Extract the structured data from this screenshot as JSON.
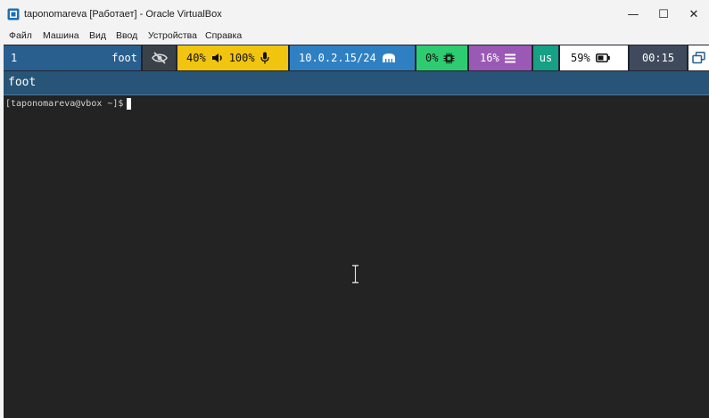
{
  "window": {
    "title": "taponomareva [Работает] - Oracle VirtualBox",
    "minimize_glyph": "—",
    "maximize_glyph": "☐",
    "close_glyph": "✕"
  },
  "menu": [
    {
      "label": "Файл"
    },
    {
      "label": "Машина"
    },
    {
      "label": "Вид"
    },
    {
      "label": "Ввод"
    },
    {
      "label": "Устройства"
    },
    {
      "label": "Справка"
    }
  ],
  "statusbar": {
    "workspace_number": "1",
    "window_name": "foot",
    "idle_icon": "eye-slash-icon",
    "volume": "40%",
    "volume_icon": "speaker-icon",
    "mic": "100%",
    "mic_icon": "microphone-icon",
    "ip": "10.0.2.15/24",
    "network_icon": "ethernet-icon",
    "cpu": "0%",
    "cpu_icon": "cpu-chip-icon",
    "memory": "16%",
    "memory_icon": "memory-icon",
    "keyboard_layout": "us",
    "battery": "59%",
    "battery_icon": "battery-icon",
    "clock": "00:15",
    "tray_icon": "windows-stack-icon"
  },
  "terminal": {
    "title": "foot",
    "prompt": "[taponomareva@vbox ~]$"
  },
  "colors": {
    "workspace_bg": "#285f8e",
    "audio_bg": "#f1c40f",
    "network_bg": "#2f80c3",
    "cpu_bg": "#2ecc71",
    "memory_bg": "#9b59b6",
    "lang_bg": "#16a085",
    "battery_bg": "#ffffff",
    "clock_bg": "#3f4b5c",
    "terminal_title_bg": "#285577",
    "terminal_bg": "#232323"
  }
}
